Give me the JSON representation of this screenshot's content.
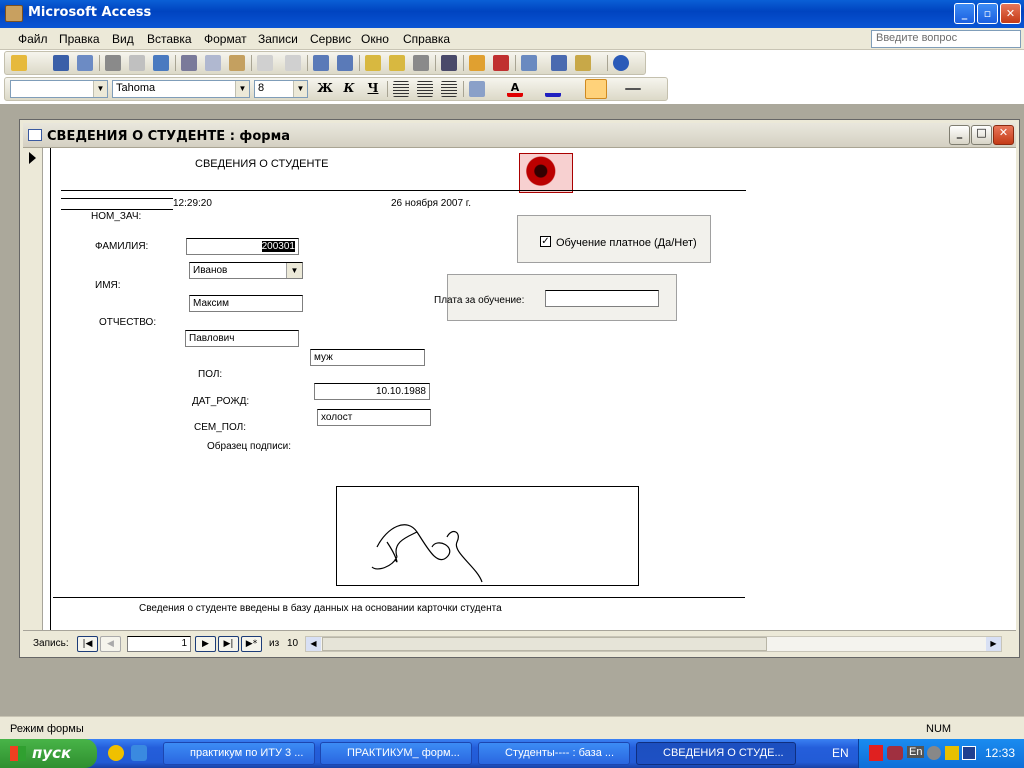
{
  "window": {
    "title": "Microsoft Access",
    "min": "_",
    "max": "▫",
    "close": "✕"
  },
  "menu": [
    "Файл",
    "Правка",
    "Вид",
    "Вставка",
    "Формат",
    "Записи",
    "Сервис",
    "Окно",
    "Справка"
  ],
  "ask": {
    "placeholder": "Введите вопрос"
  },
  "format": {
    "font": "Tahoma",
    "size": "8",
    "bold": "Ж",
    "italic": "К",
    "underline": "Ч"
  },
  "form": {
    "title": "СВЕДЕНИЯ О СТУДЕНТЕ : форма",
    "header": "СВЕДЕНИЯ О СТУДЕНТЕ",
    "time": "12:29:20",
    "date": "26 ноября 2007 г.",
    "labels": {
      "nom_zach": "НОМ_ЗАЧ:",
      "familiya": "ФАМИЛИЯ:",
      "imya": "ИМЯ:",
      "otchestvo": "ОТЧЕСТВО:",
      "pol": "ПОЛ:",
      "dat_rozhd": "ДАТ_РОЖД:",
      "sem_pol": "СЕМ_ПОЛ:",
      "podpis": "Образец подписи:",
      "platno": "Обучение платное (Да/Нет)",
      "plata": "Плата за обучение:"
    },
    "values": {
      "nom_zach": "200301",
      "familiya": "Иванов",
      "imya": "Максим",
      "otchestvo": "Павлович",
      "pol": "муж",
      "dat_rozhd": "10.10.1988",
      "sem_pol": "холост",
      "plata": ""
    },
    "paid_checked": true,
    "footer": "Сведения о студенте введены в базу данных на основании карточки студента"
  },
  "record_nav": {
    "label": "Запись:",
    "current": "1",
    "of": "из",
    "total": "10"
  },
  "status": {
    "mode": "Режим формы",
    "num": "NUM"
  },
  "taskbar": {
    "start": "пуск",
    "items": [
      "практикум по ИТУ 3 ...",
      "ПРАКТИКУМ_ форм...",
      "Студенты---- : база ...",
      "СВЕДЕНИЯ О СТУДЕ..."
    ],
    "lang": "EN",
    "tray_lang": "En",
    "clock": "12:33"
  },
  "colors": {
    "titlebar": "#0a54d4",
    "taskbar": "#245edb",
    "start": "#2f8f2f",
    "mdi": "#aba89b"
  }
}
